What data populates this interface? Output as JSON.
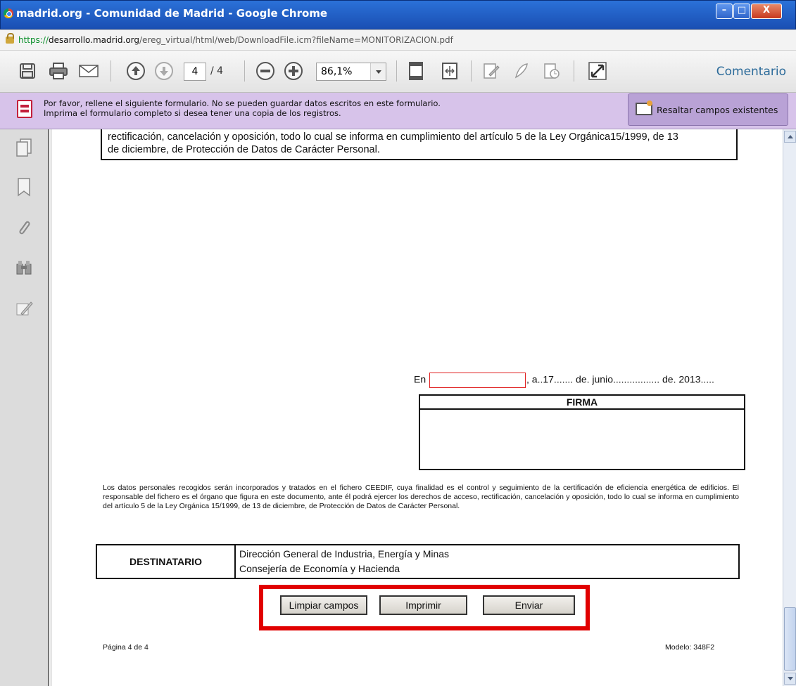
{
  "window": {
    "title": "madrid.org - Comunidad de Madrid - Google Chrome",
    "min_label": "–",
    "max_label": "□",
    "close_label": "X"
  },
  "address": {
    "scheme": "https://",
    "host": "desarrollo.madrid.org",
    "path": "/ereg_virtual/html/web/DownloadFile.icm?fileName=MONITORIZACION.pdf"
  },
  "toolbar": {
    "current_page": "4",
    "total_pages": "/ 4",
    "zoom": "86,1%",
    "comment_label": "Comentario",
    "icons": [
      "save-icon",
      "print-icon",
      "email-icon",
      "previous-page-icon",
      "next-page-icon",
      "zoom-out-icon",
      "zoom-in-icon",
      "fit-page-icon",
      "fit-width-icon",
      "sign-icon",
      "pen-icon",
      "timestamp-icon",
      "fullscreen-icon"
    ]
  },
  "form_notice": {
    "line1": "Por favor, rellene el siguiente formulario. No se pueden guardar datos escritos en este formulario.",
    "line2": "Imprima el formulario completo si desea tener una copia de los registros.",
    "highlight_button": "Resaltar campos existentes"
  },
  "left_pane": {
    "icons": [
      "pages-icon",
      "bookmarks-icon",
      "attachments-icon",
      "search-icon",
      "signatures-icon"
    ]
  },
  "document": {
    "top_text_line1": "rectificación, cancelación y oposición, todo lo cual se informa en cumplimiento del artículo 5 de la Ley Orgánica15/1999, de 13",
    "top_text_line2": "de diciembre, de Protección de Datos de Carácter Personal.",
    "en_label": "En",
    "en_value": "",
    "date_tail": ", a..17....... de. junio................. de. 2013.....",
    "firma_label": "FIRMA",
    "lopd_text": "Los datos personales recogidos serán incorporados y tratados en el fichero CEEDIF, cuya finalidad es el control y seguimiento de la certificación de eficiencia energética de edificios. El responsable del fichero es el órgano que figura en este documento, ante él podrá ejercer los derechos de acceso, rectificación, cancelación y oposición, todo lo cual se informa en cumplimiento del artículo 5 de la Ley Orgánica 15/1999, de 13 de diciembre, de Protección de Datos de Carácter Personal.",
    "destinatario_label": "DESTINATARIO",
    "destinatario_line1": "Dirección General de Industria, Energía y Minas",
    "destinatario_line2": "Consejería de Economía y Hacienda",
    "buttons": {
      "clear": "Limpiar campos",
      "print": "Imprimir",
      "send": "Enviar"
    },
    "footer_left": "Página 4 de 4",
    "footer_right": "Modelo: 348F2"
  },
  "colors": {
    "title_bar": "#1f5fcc",
    "form_bar": "#d7c3ea",
    "highlight_frame": "#e10000",
    "field_border": "#e02020"
  }
}
